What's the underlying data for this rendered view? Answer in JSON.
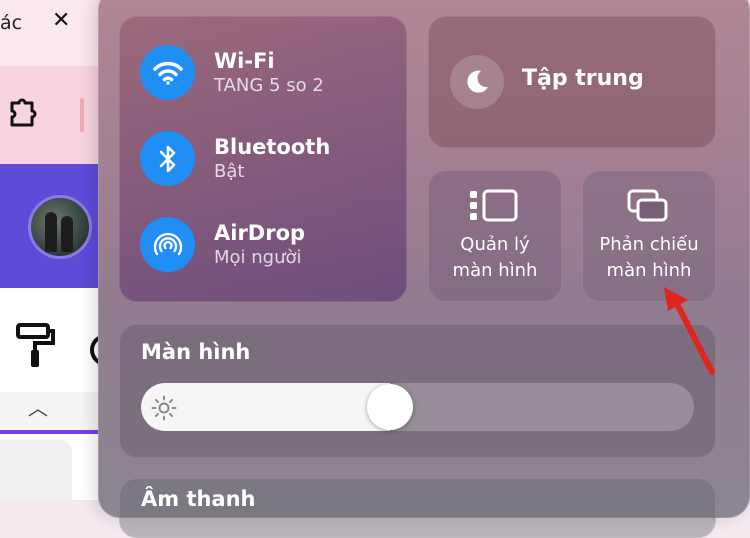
{
  "background_window": {
    "tab_text": "ác",
    "close_glyph": "✕",
    "caret_glyph": "︿"
  },
  "control_center": {
    "network": [
      {
        "title": "Wi-Fi",
        "subtitle": "TANG 5 so 2",
        "icon": "wifi-icon"
      },
      {
        "title": "Bluetooth",
        "subtitle": "Bật",
        "icon": "bluetooth-icon"
      },
      {
        "title": "AirDrop",
        "subtitle": "Mọi người",
        "icon": "airdrop-icon"
      }
    ],
    "focus": {
      "label": "Tập trung",
      "icon": "moon-icon"
    },
    "stage_manager": {
      "line1": "Quản lý",
      "line2": "màn hình",
      "icon": "stage-manager-icon"
    },
    "screen_mirroring": {
      "line1": "Phản chiếu",
      "line2": "màn hình",
      "icon": "screen-mirroring-icon"
    },
    "display": {
      "label": "Màn hình",
      "brightness": 0.45,
      "icon": "sun-icon"
    },
    "sound": {
      "label": "Âm thanh"
    }
  },
  "colors": {
    "accent": "#1f8ef5",
    "annotation_arrow": "#e0241f"
  }
}
